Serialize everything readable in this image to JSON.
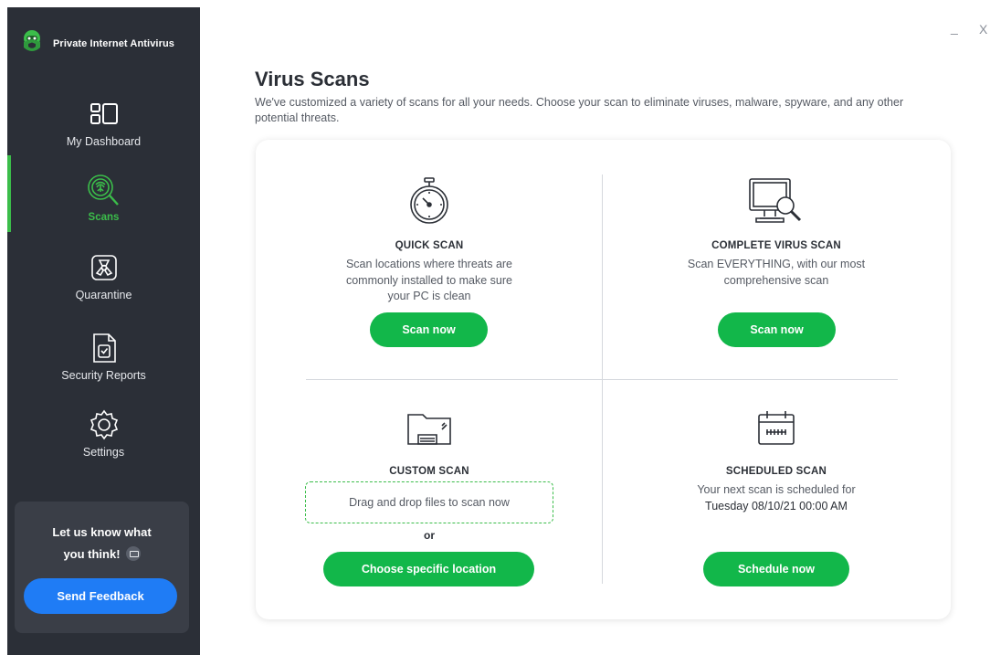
{
  "app": {
    "name": "Private Internet Antivirus"
  },
  "window": {
    "minimize": "_",
    "close": "X"
  },
  "sidebar": {
    "items": [
      {
        "label": "My Dashboard",
        "icon": "dashboard-icon"
      },
      {
        "label": "Scans",
        "icon": "fingerprint-scan-icon",
        "active": true
      },
      {
        "label": "Quarantine",
        "icon": "biohazard-icon"
      },
      {
        "label": "Security Reports",
        "icon": "report-icon"
      },
      {
        "label": "Settings",
        "icon": "gear-icon"
      }
    ],
    "feedback": {
      "line1": "Let us know what",
      "line2": "you think!",
      "button": "Send Feedback"
    }
  },
  "main": {
    "title": "Virus Scans",
    "description": "We've customized a variety of scans for all your needs. Choose your scan to eliminate viruses, malware, spyware, and any other potential threats.",
    "quick": {
      "title": "QUICK SCAN",
      "desc_lines": [
        "Scan locations where threats are",
        "commonly installed to make sure",
        "your PC is clean"
      ],
      "button": "Scan now"
    },
    "complete": {
      "title": "COMPLETE VIRUS SCAN",
      "desc_lines": [
        "Scan EVERYTHING, with our most",
        "comprehensive scan"
      ],
      "button": "Scan now"
    },
    "custom": {
      "title": "CUSTOM SCAN",
      "dropzone": "Drag and drop files to scan now",
      "or": "or",
      "button": "Choose specific location"
    },
    "scheduled": {
      "title": "SCHEDULED SCAN",
      "desc_lines": [
        "Your next scan is scheduled for",
        "Tuesday 08/10/21 00:00 AM"
      ],
      "button": "Schedule now"
    }
  },
  "colors": {
    "accent_green": "#12b74a",
    "sidebar_bg": "#2b2f37",
    "feedback_blue": "#1f7cf5",
    "active_green": "#3bbd4a"
  }
}
